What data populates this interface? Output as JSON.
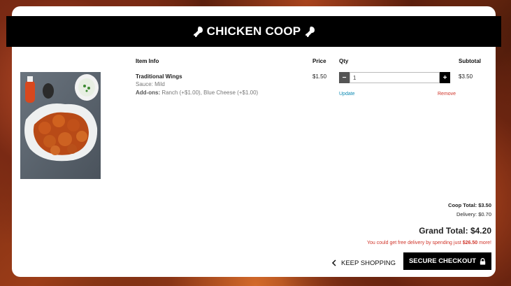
{
  "header": {
    "brand": "CHICKEN COOP"
  },
  "cart": {
    "columns": {
      "info": "Item Info",
      "price": "Price",
      "qty": "Qty",
      "subtotal": "Subtotal"
    },
    "item": {
      "name": "Traditional Wings",
      "sauce": "Sauce: Mild",
      "addons_label": "Add-ons:",
      "addons_value": " Ranch (+$1.00), Blue Cheese (+$1.00)",
      "price": "$1.50",
      "quantity": "1",
      "subtotal": "$3.50",
      "minus": "−",
      "plus": "+",
      "update": "Update",
      "remove": "Remove"
    }
  },
  "summary": {
    "coop_total": "Coop Total: $3.50",
    "delivery": "Delivery: $0.70",
    "grand_total": "Grand Total: $4.20",
    "promo_prefix": "You could get free delivery by spending just ",
    "promo_amount": "$26.50",
    "promo_suffix": " more!"
  },
  "actions": {
    "keep_shopping": "KEEP SHOPPING",
    "checkout": "SECURE CHECKOUT"
  },
  "icons": {
    "brand_left": "drumstick-icon",
    "brand_right": "drumstick-icon",
    "back": "chevron-left-icon",
    "lock": "lock-icon"
  },
  "colors": {
    "accent_link": "#0d8ab3",
    "danger": "#d0352a",
    "bar": "#000000"
  }
}
